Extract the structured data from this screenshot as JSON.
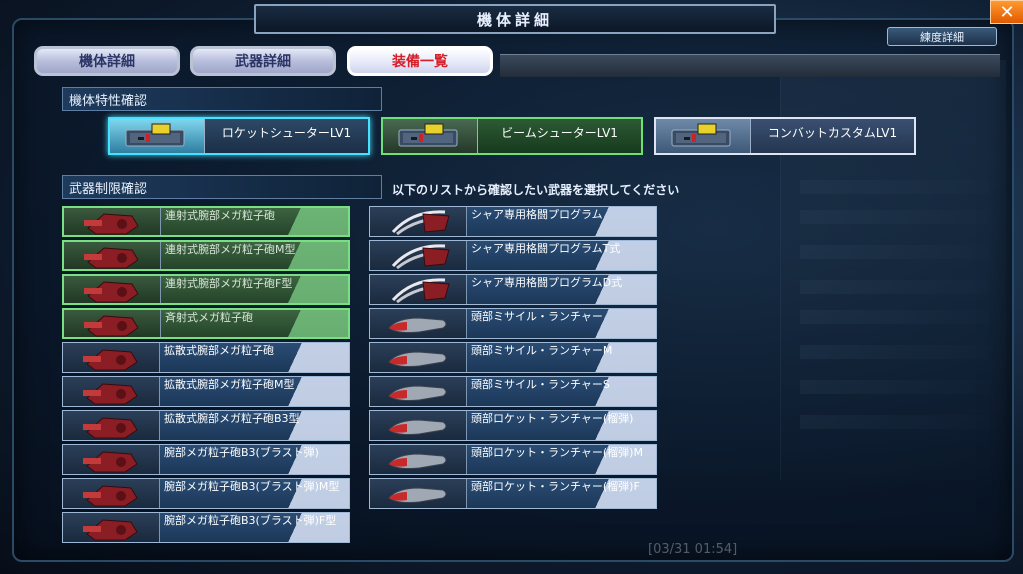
{
  "window": {
    "title": "機体詳細"
  },
  "top_right": {
    "proficiency_button": "練度詳細",
    "close_label": "✕"
  },
  "tabs": [
    {
      "label": "機体詳細",
      "active": false
    },
    {
      "label": "武器詳細",
      "active": false
    },
    {
      "label": "装備一覧",
      "active": true
    }
  ],
  "traits_section": {
    "header": "機体特性確認",
    "items": [
      {
        "label": "ロケットシューターLV1",
        "state": "highlighted"
      },
      {
        "label": "ビームシューターLV1",
        "state": "selected"
      },
      {
        "label": "コンバットカスタムLV1",
        "state": "normal"
      }
    ]
  },
  "weapons_section": {
    "header": "武器制限確認",
    "instruction": "以下のリストから確認したい武器を選択してください",
    "left_column": [
      {
        "label": "連射式腕部メガ粒子砲",
        "selected": true
      },
      {
        "label": "連射式腕部メガ粒子砲M型",
        "selected": true
      },
      {
        "label": "連射式腕部メガ粒子砲F型",
        "selected": true
      },
      {
        "label": "斉射式メガ粒子砲",
        "selected": true
      },
      {
        "label": "拡散式腕部メガ粒子砲",
        "selected": false
      },
      {
        "label": "拡散式腕部メガ粒子砲M型",
        "selected": false
      },
      {
        "label": "拡散式腕部メガ粒子砲B3型",
        "selected": false
      },
      {
        "label": "腕部メガ粒子砲B3(ブラスト弾)",
        "selected": false
      },
      {
        "label": "腕部メガ粒子砲B3(ブラスト弾)M型",
        "selected": false
      },
      {
        "label": "腕部メガ粒子砲B3(ブラスト弾)F型",
        "selected": false
      }
    ],
    "right_column": [
      {
        "label": "シャア専用格闘プログラム",
        "icon": "claw"
      },
      {
        "label": "シャア専用格闘プログラムT式",
        "icon": "claw"
      },
      {
        "label": "シャア専用格闘プログラムD式",
        "icon": "claw"
      },
      {
        "label": "頭部ミサイル・ランチャー",
        "icon": "missile"
      },
      {
        "label": "頭部ミサイル・ランチャーM",
        "icon": "missile"
      },
      {
        "label": "頭部ミサイル・ランチャーS",
        "icon": "missile"
      },
      {
        "label": "頭部ロケット・ランチャー(榴弾)",
        "icon": "missile"
      },
      {
        "label": "頭部ロケット・ランチャー(榴弾)M",
        "icon": "missile"
      },
      {
        "label": "頭部ロケット・ランチャー(榴弾)F",
        "icon": "missile"
      }
    ]
  },
  "footer": {
    "timestamp": "[03/31 01:54]"
  }
}
